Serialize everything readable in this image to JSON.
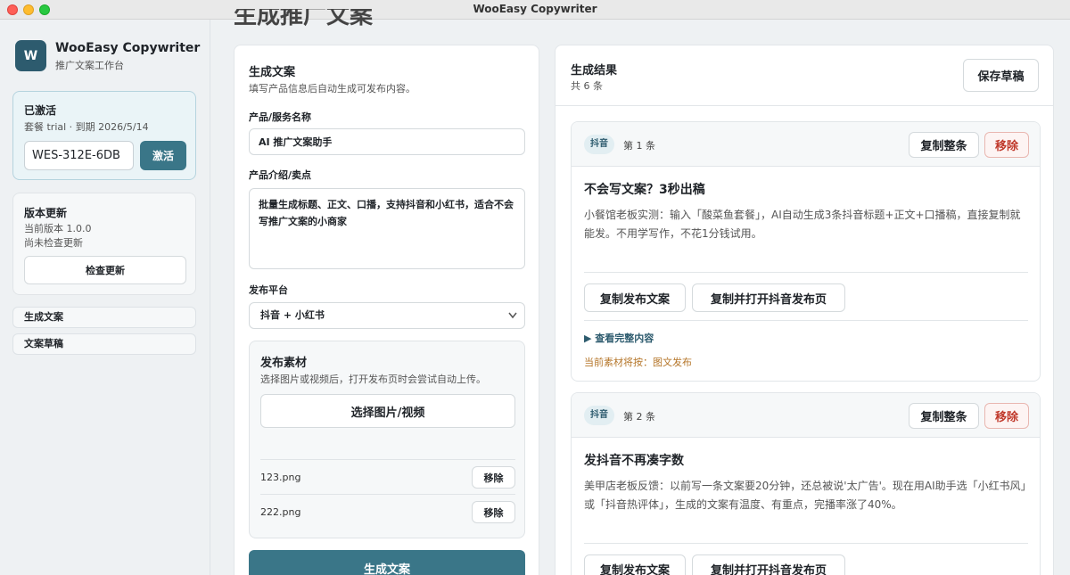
{
  "window": {
    "title": "WooEasy Copywriter"
  },
  "sidebar": {
    "logo_letter": "W",
    "app_name": "WooEasy Copywriter",
    "app_subtitle": "推广文案工作台",
    "activation": {
      "title": "已激活",
      "info": "套餐 trial · 到期 2026/5/14",
      "key_value": "WES-312E-6DB",
      "button": "激活"
    },
    "update": {
      "title": "版本更新",
      "current_version": "当前版本 1.0.0",
      "status": "尚未检查更新",
      "button": "检查更新"
    },
    "nav": [
      "生成文案",
      "文案草稿"
    ]
  },
  "page": {
    "title": "生成推广文案"
  },
  "form": {
    "title": "生成文案",
    "subtitle": "填写产品信息后自动生成可发布内容。",
    "name_label": "产品/服务名称",
    "name_value": "AI 推广文案助手",
    "desc_label": "产品介绍/卖点",
    "desc_value": "批量生成标题、正文、口播，支持抖音和小红书，适合不会写推广文案的小商家",
    "platform_label": "发布平台",
    "platform_value": "抖音 + 小红书",
    "media": {
      "title": "发布素材",
      "subtitle": "选择图片或视频后，打开发布页时会尝试自动上传。",
      "choose_button": "选择图片/视频",
      "files": [
        {
          "name": "123.png",
          "remove": "移除"
        },
        {
          "name": "222.png",
          "remove": "移除"
        }
      ]
    },
    "generate_button": "生成文案"
  },
  "results": {
    "title": "生成结果",
    "count": "共 6 条",
    "save_button": "保存草稿",
    "items": [
      {
        "platform": "抖音",
        "index": "第 1 条",
        "copy_all": "复制整条",
        "remove": "移除",
        "headline": "不会写文案？3秒出稿",
        "body": "小餐馆老板实测：输入「酸菜鱼套餐」，AI自动生成3条抖音标题+正文+口播稿，直接复制就能发。不用学写作，不花1分钱试用。",
        "copy_post": "复制发布文案",
        "copy_open": "复制并打开抖音发布页",
        "details": "▶ 查看完整内容",
        "note": "当前素材将按：图文发布"
      },
      {
        "platform": "抖音",
        "index": "第 2 条",
        "copy_all": "复制整条",
        "remove": "移除",
        "headline": "发抖音不再凑字数",
        "body": "美甲店老板反馈：以前写一条文案要20分钟，还总被说'太广告'。现在用AI助手选「小红书风」或「抖音热评体」，生成的文案有温度、有重点，完播率涨了40%。",
        "copy_post": "复制发布文案",
        "copy_open": "复制并打开抖音发布页"
      }
    ]
  }
}
